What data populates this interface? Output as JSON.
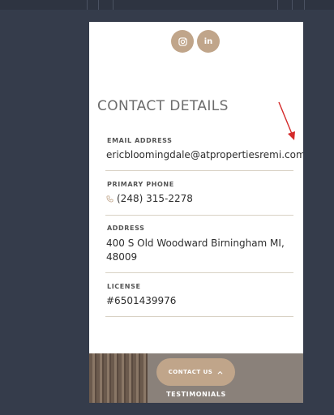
{
  "social": {
    "instagram_icon": "instagram-icon",
    "linkedin_label": "in"
  },
  "contact": {
    "heading": "CONTACT DETAILS",
    "email_label": "EMAIL ADDRESS",
    "email_value": "ericbloomingdale@atpropertiesremi.com",
    "phone_label": "PRIMARY PHONE",
    "phone_value": "(248) 315-2278",
    "address_label": "ADDRESS",
    "address_line1": "400 S Old Woodward Birningham MI,",
    "address_line2": "48009",
    "license_label": "LICENSE",
    "license_value": "#6501439976"
  },
  "footer": {
    "contact_button": "CONTACT US",
    "testimonials": "TESTIMONIALS"
  },
  "colors": {
    "accent": "#c0a58a",
    "annotation_arrow": "#d42a2a"
  }
}
